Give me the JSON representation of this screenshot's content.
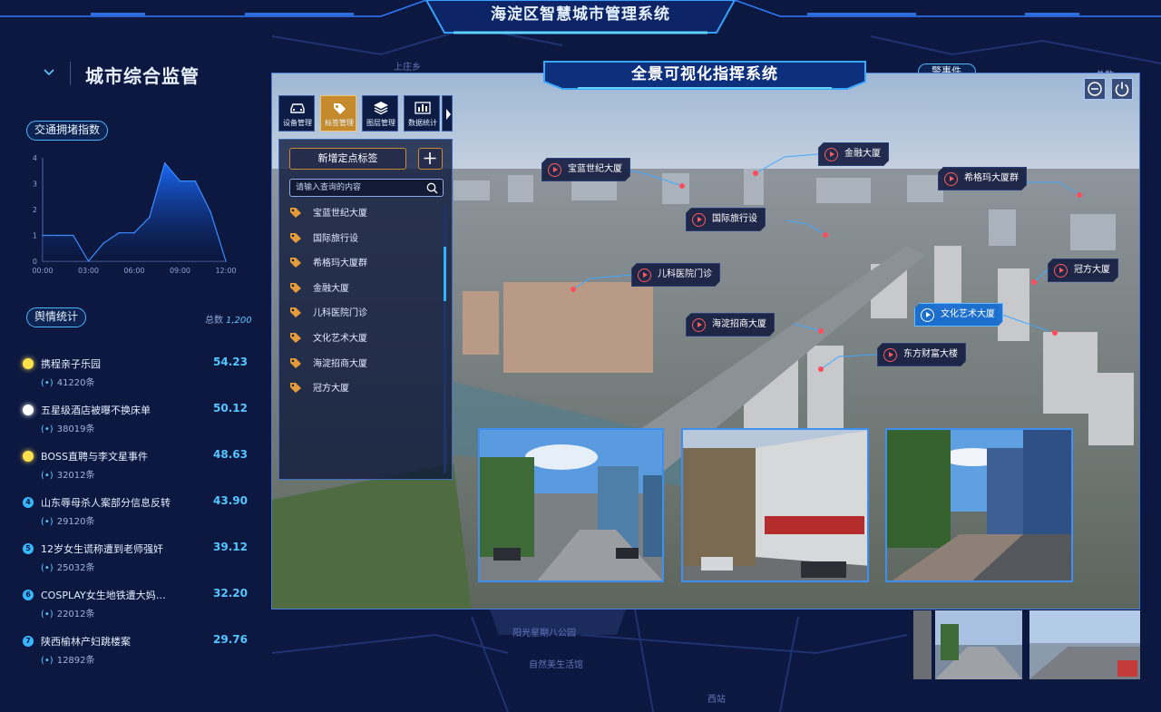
{
  "header": {
    "title": "海淀区智慧城市管理系统"
  },
  "map": {
    "labels": [
      {
        "name": "map-label-shangzhuang",
        "text": "上庄乡"
      },
      {
        "name": "map-label-yangguang",
        "text": "阳光星期八公园"
      },
      {
        "name": "map-label-ziran",
        "text": "自然美生活馆"
      },
      {
        "name": "map-label-xizhan",
        "text": "西站"
      }
    ]
  },
  "left_panel": {
    "title": "城市综合监管",
    "traffic": {
      "label": "交通拥堵指数",
      "chart_data": {
        "type": "area",
        "title": "",
        "xlabel": "",
        "ylabel": "",
        "x": [
          "00:00",
          "01:00",
          "02:00",
          "03:00",
          "04:00",
          "05:00",
          "06:00",
          "07:00",
          "08:00",
          "09:00",
          "10:00",
          "11:00",
          "12:00"
        ],
        "x_tick_labels": [
          "00:00",
          "03:00",
          "06:00",
          "09:00",
          "12:00"
        ],
        "values": [
          1.0,
          1.0,
          1.0,
          0.0,
          0.7,
          1.1,
          1.1,
          1.7,
          3.8,
          3.1,
          3.1,
          1.9,
          0.0
        ],
        "ylim": [
          0,
          4
        ],
        "y_ticks": [
          0,
          1,
          2,
          3,
          4
        ],
        "grid": false,
        "colors": {
          "fill_top": "#1a6bff",
          "fill_bottom": "#0b1538",
          "line": "#3f8cff"
        }
      }
    },
    "sentiment": {
      "label": "舆情统计",
      "total_label": "总数",
      "total_value": "1,200",
      "items": [
        {
          "rank": "",
          "dot_color": "#ffe14d",
          "title": "携程亲子乐园",
          "score": "54.23",
          "count": "41220条"
        },
        {
          "rank": "",
          "dot_color": "#ffffff",
          "title": "五星级酒店被曝不换床单",
          "score": "50.12",
          "count": "38019条"
        },
        {
          "rank": "",
          "dot_color": "#ffe14d",
          "title": "BOSS直聘与李文星事件",
          "score": "48.63",
          "count": "32012条"
        },
        {
          "rank": "4",
          "dot_color": "#35b8ff",
          "title": "山东辱母杀人案部分信息反转",
          "score": "43.90",
          "count": "29120条"
        },
        {
          "rank": "5",
          "dot_color": "#35b8ff",
          "title": "12岁女生谎称遭到老师强奸",
          "score": "39.12",
          "count": "25032条"
        },
        {
          "rank": "6",
          "dot_color": "#35b8ff",
          "title": "COSPLAY女生地铁遭大妈…",
          "score": "32.20",
          "count": "22012条"
        },
        {
          "rank": "7",
          "dot_color": "#35b8ff",
          "title": "陕西榆林产妇跳楼案",
          "score": "29.76",
          "count": "12892条"
        }
      ]
    }
  },
  "right_panel": {
    "alarm_label": "警事件",
    "total_label": "总数"
  },
  "command": {
    "title": "全景可视化指挥系统",
    "toolbar": [
      {
        "name": "tool-device-management",
        "label": "设备管理",
        "icon": "car-icon",
        "active": false
      },
      {
        "name": "tool-tag-management",
        "label": "标签管理",
        "icon": "tag-icon",
        "active": true
      },
      {
        "name": "tool-layer-management",
        "label": "图层管理",
        "icon": "layers-icon",
        "active": false
      },
      {
        "name": "tool-data-statistics",
        "label": "数据统计",
        "icon": "bar-chart-icon",
        "active": false
      }
    ],
    "tag_panel": {
      "add_label": "新增定点标签",
      "search_placeholder": "请输入查询的内容",
      "tags": [
        "宝蓝世纪大厦",
        "国际旅行设",
        "希格玛大厦群",
        "金融大厦",
        "儿科医院门诊",
        "文化艺术大厦",
        "海淀招商大厦",
        "冠方大厦"
      ]
    },
    "markers": [
      "宝蓝世纪大厦",
      "金融大厦",
      "希格玛大厦群",
      "国际旅行设",
      "儿科医院门诊",
      "冠方大厦",
      "文化艺术大厦",
      "海淀招商大厦",
      "东方财富大楼"
    ],
    "highlighted_marker": "文化艺术大厦",
    "colors": {
      "accent": "#4fb7ff",
      "active_tool": "#c48a2c",
      "marker_dot": "#ff4d5e"
    }
  }
}
